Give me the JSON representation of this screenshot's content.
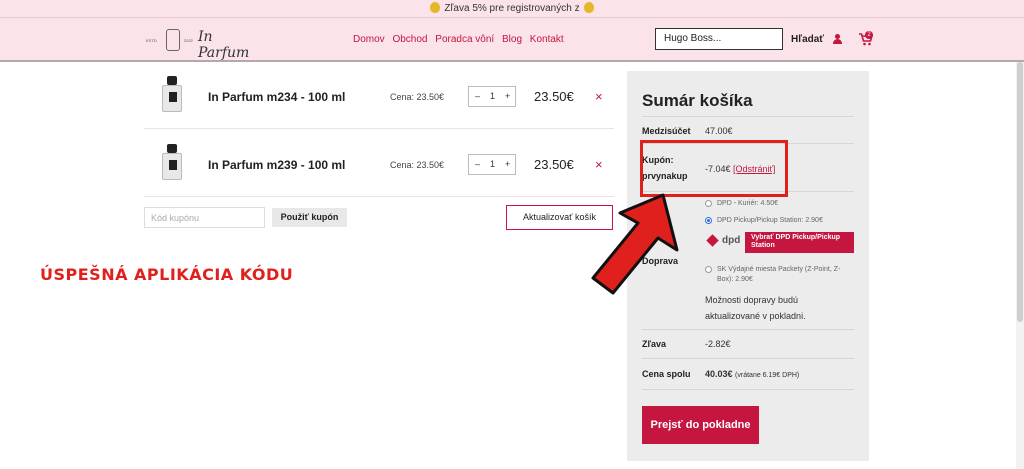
{
  "promo": {
    "text": "Zľava 5% pre registrovaných z"
  },
  "header": {
    "logo": {
      "estd": "ESTD",
      "year": "2022",
      "script": "In Parfum"
    },
    "nav": [
      "Domov",
      "Obchod",
      "Poradca vôní",
      "Blog",
      "Kontakt"
    ],
    "search": {
      "value": "Hugo Boss...",
      "button": "Hľadať"
    },
    "cart_count": "2"
  },
  "cart": {
    "items": [
      {
        "name": "In Parfum m234 - 100 ml",
        "price": "Cena: 23.50€",
        "minus": "–",
        "qty": "1",
        "plus": "+",
        "total": "23.50€",
        "remove": "×"
      },
      {
        "name": "In Parfum m239 - 100 ml",
        "price": "Cena: 23.50€",
        "minus": "–",
        "qty": "1",
        "plus": "+",
        "total": "23.50€",
        "remove": "×"
      }
    ],
    "coupon_placeholder": "Kód kupónu",
    "apply_coupon": "Použiť kupón",
    "update_cart": "Aktualizovať košík"
  },
  "annotation": "ÚSPEŠNÁ APLIKÁCIA KÓDU",
  "summary": {
    "title": "Sumár košíka",
    "subtotal_label": "Medzisúčet",
    "subtotal_value": "47.00€",
    "coupon_label_1": "Kupón:",
    "coupon_label_2": "prvynakup",
    "coupon_value": "-7.04€",
    "coupon_remove": "[Odstrániť]",
    "shipping_label": "Doprava",
    "shipping_options": [
      "DPD - Kuriér: 4.50€",
      "DPD Pickup/Pickup Station: 2.90€",
      "SK Výdajné miesta Packety (Z-Point, Z-Box): 2.90€"
    ],
    "dpd_logo": "dpd",
    "dpd_button": "Vybrať DPD Pickup/Pickup Station",
    "shipping_note": "Možnosti dopravy budú aktualizované v pokladni.",
    "discount_label": "Zľava",
    "discount_value": "-2.82€",
    "total_label": "Cena spolu",
    "total_value": "40.03€",
    "total_vat": "(vrátane 6.19€ DPH)",
    "checkout": "Prejsť do pokladne"
  }
}
